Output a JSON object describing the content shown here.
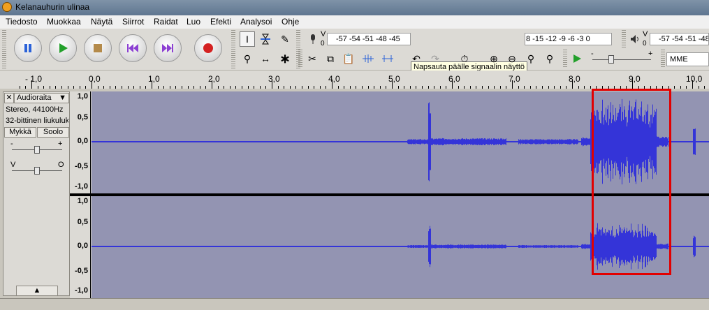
{
  "window": {
    "title": "Kelanauhurin ulinaa"
  },
  "menu": [
    "Tiedosto",
    "Muokkaa",
    "Näytä",
    "Siirrot",
    "Raidat",
    "Luo",
    "Efekti",
    "Analysoi",
    "Ohje"
  ],
  "transport": {
    "buttons": [
      {
        "name": "pause-button",
        "icon": "pause-icon",
        "color": "#2b62d8"
      },
      {
        "name": "play-button",
        "icon": "play-icon",
        "color": "#23a02b"
      },
      {
        "name": "stop-button",
        "icon": "stop-icon",
        "color": "#b48a4a"
      },
      {
        "name": "skip-start-button",
        "icon": "skip-start-icon",
        "color": "#8c3fd3"
      },
      {
        "name": "skip-end-button",
        "icon": "skip-end-icon",
        "color": "#8c3fd3"
      },
      {
        "name": "record-button",
        "icon": "record-icon",
        "color": "#d42121"
      }
    ]
  },
  "meters": {
    "record_label": "V",
    "record_channel": "0",
    "record_scale": "-57 -54 -51 -48 -45",
    "record_scale_end": "8 -15 -12 -9 -6 -3 0",
    "tooltip": "Napsauta päälle signaalin näyttö",
    "play_label": "V",
    "play_channel": "0",
    "play_scale": "-57 -54 -51 -48 -45"
  },
  "device": {
    "host": "MME"
  },
  "ruler": {
    "labels": [
      "- 1,0",
      "0,0",
      "1,0",
      "2,0",
      "3,0",
      "4,0",
      "5,0",
      "6,0",
      "7,0",
      "8,0",
      "9,0",
      "10,0"
    ]
  },
  "track": {
    "name": "Audioraita",
    "info1": "Stereo, 44100Hz",
    "info2": "32-bittinen liukuluku",
    "mute": "Mykkä",
    "solo": "Soolo",
    "gain_minus": "-",
    "gain_plus": "+",
    "pan_left": "V",
    "pan_right": "O",
    "vscale": [
      "1,0",
      "0,5",
      "0,0",
      "-0,5",
      "-1,0"
    ]
  },
  "colors": {
    "waveform": "#3434d8",
    "background": "#9394b2",
    "selection": "#e20000"
  }
}
